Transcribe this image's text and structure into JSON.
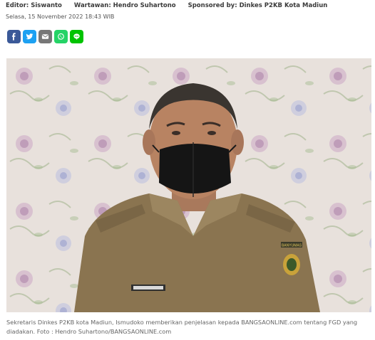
{
  "meta": {
    "editor": "Editor: Siswanto",
    "reporter": "Wartawan: Hendro Suhartono",
    "sponsor": "Sponsored by: Dinkes P2KB Kota Madiun"
  },
  "date": "Selasa, 15 November 2022 18:43 WIB",
  "share": [
    {
      "name": "facebook-share-button",
      "icon": "facebook-icon",
      "color": "#3b5998"
    },
    {
      "name": "twitter-share-button",
      "icon": "twitter-icon",
      "color": "#1da1f2"
    },
    {
      "name": "email-share-button",
      "icon": "envelope-icon",
      "color": "#777777"
    },
    {
      "name": "whatsapp-share-button",
      "icon": "whatsapp-icon",
      "color": "#25d366"
    },
    {
      "name": "line-share-button",
      "icon": "line-icon",
      "color": "#00c300"
    }
  ],
  "photo": {
    "badge_text": "BANYUMAS",
    "caption": "Sekretaris Dinkes P2KB kota Madiun, Ismudoko memberikan penjelasan kepada BANGSAONLINE.com tentang FGD yang diadakan. Foto : Hendro Suhartono/BANGSAONLINE.com"
  }
}
